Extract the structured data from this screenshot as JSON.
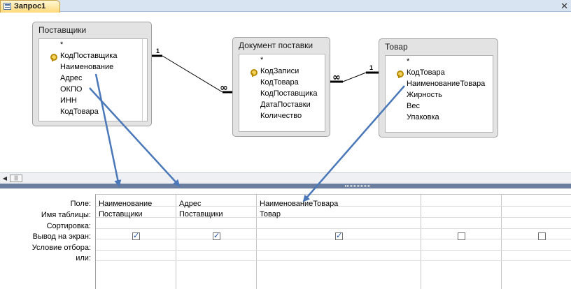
{
  "tab": {
    "title": "Запрос1"
  },
  "tables": [
    {
      "title": "Поставщики",
      "fields": [
        "*",
        "КодПоставщика",
        "Наименование",
        "Адрес",
        "ОКПО",
        "ИНН",
        "КодТовара"
      ]
    },
    {
      "title": "Документ поставки",
      "fields": [
        "*",
        "КодЗаписи",
        "КодТовара",
        "КодПоставщика",
        "ДатаПоставки",
        "Количество"
      ]
    },
    {
      "title": "Товар",
      "fields": [
        "*",
        "КодТовара",
        "НаименованиеТовара",
        "Жирность",
        "Вес",
        "Упаковка"
      ]
    }
  ],
  "relations": {
    "r1_one": "1",
    "r1_many": "∞",
    "r2_many": "∞",
    "r2_one": "1"
  },
  "grid": {
    "row_labels": [
      "Поле:",
      "Имя таблицы:",
      "Сортировка:",
      "Вывод на экран:",
      "Условие отбора:",
      "или:"
    ],
    "columns": [
      {
        "field": "Наименование",
        "table": "Поставщики",
        "show": true
      },
      {
        "field": "Адрес",
        "table": "Поставщики",
        "show": true
      },
      {
        "field": "НаименованиеТовара",
        "table": "Товар",
        "show": true
      },
      {
        "field": "",
        "table": "",
        "show": false
      },
      {
        "field": "",
        "table": "",
        "show": false
      }
    ]
  },
  "colors": {
    "arrow": "#4a78b8",
    "splitter": "#6a7ea0",
    "tab_bg": "#ffd97a"
  }
}
